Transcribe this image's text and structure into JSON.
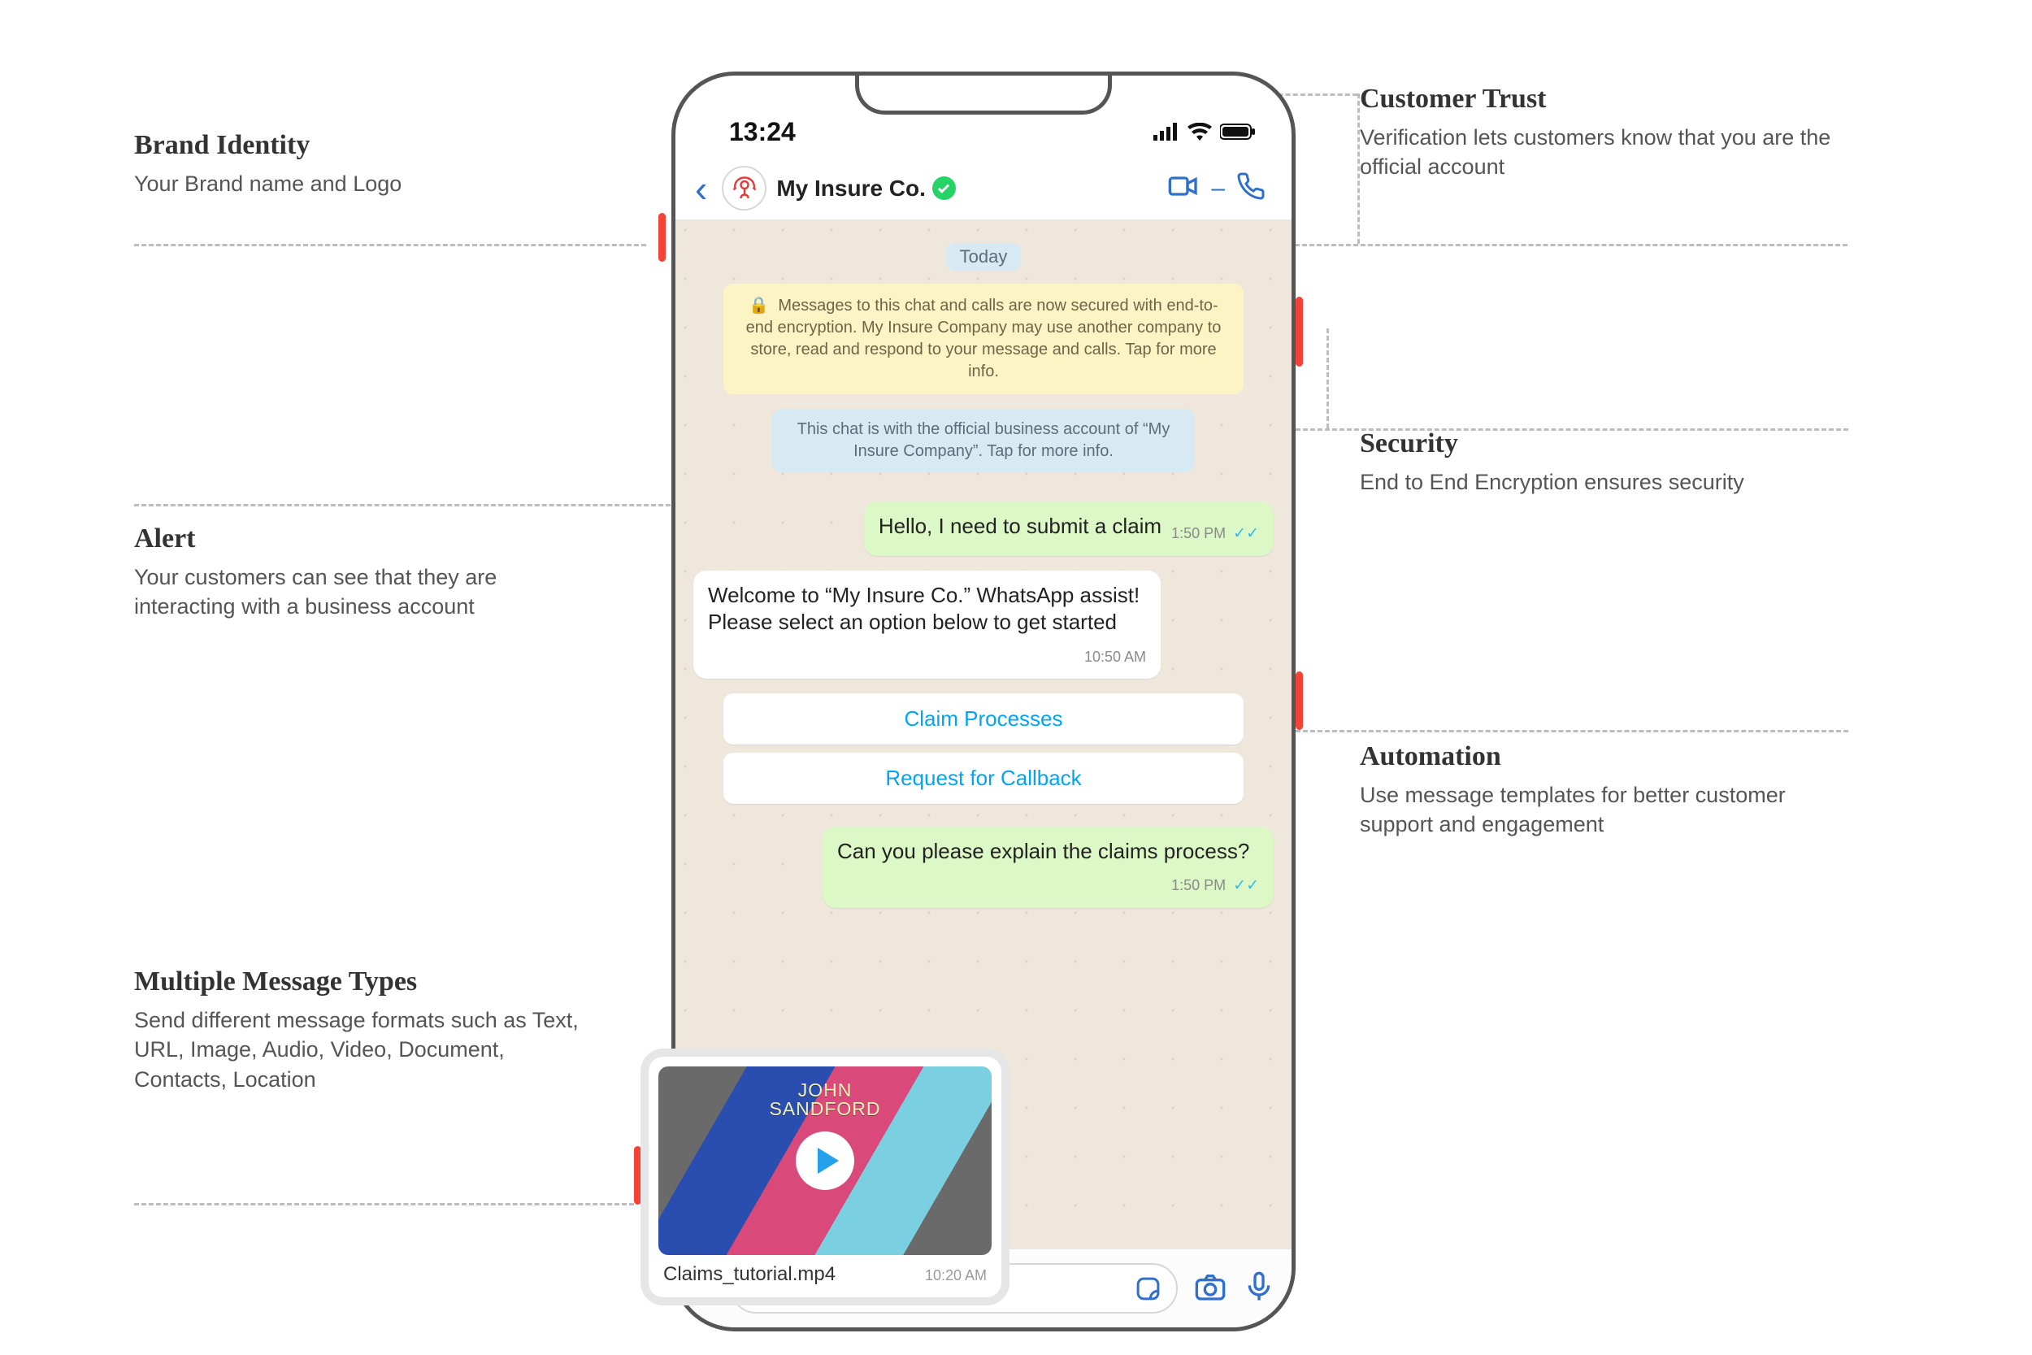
{
  "phone": {
    "status": {
      "time": "13:24"
    },
    "header": {
      "brand_name": "My Insure Co."
    },
    "day_label": "Today",
    "encryption_notice": "Messages to this chat and calls are now secured with end-to-end encryption. My Insure Company may use another company to store, read and respond to your message and calls. Tap for more info.",
    "business_notice": "This chat is with the official business account of “My Insure Company”. Tap for more info.",
    "messages": {
      "m1": {
        "text": "Hello, I need to submit a claim",
        "time": "1:50 PM"
      },
      "m2": {
        "text": "Welcome to “My Insure Co.” WhatsApp assist! Please select an option below to get started",
        "time": "10:50 AM"
      },
      "m3": {
        "text": "Can you please explain the claims process?",
        "time": "1:50 PM"
      }
    },
    "actions": {
      "a1": "Claim Processes",
      "a2": "Request for Callback"
    }
  },
  "video": {
    "filename": "Claims_tutorial.mp4",
    "time": "10:20 AM",
    "thumb_text": "JOHN\nSANDFORD"
  },
  "callouts": {
    "brand": {
      "title": "Brand Identity",
      "body": "Your Brand name and Logo"
    },
    "trust": {
      "title": "Customer Trust",
      "body": "Verification lets customers know that you are the official account"
    },
    "alert": {
      "title": "Alert",
      "body": "Your customers can see that they are interacting with a business account"
    },
    "security": {
      "title": "Security",
      "body": "End to End Encryption ensures security"
    },
    "automation": {
      "title": "Automation",
      "body": "Use message templates for better customer support and engagement"
    },
    "mmt": {
      "title": "Multiple Message Types",
      "body": "Send different message formats such as Text, URL, Image, Audio, Video, Document, Contacts, Location"
    }
  },
  "ticks": "✓✓",
  "lock": "🔒"
}
